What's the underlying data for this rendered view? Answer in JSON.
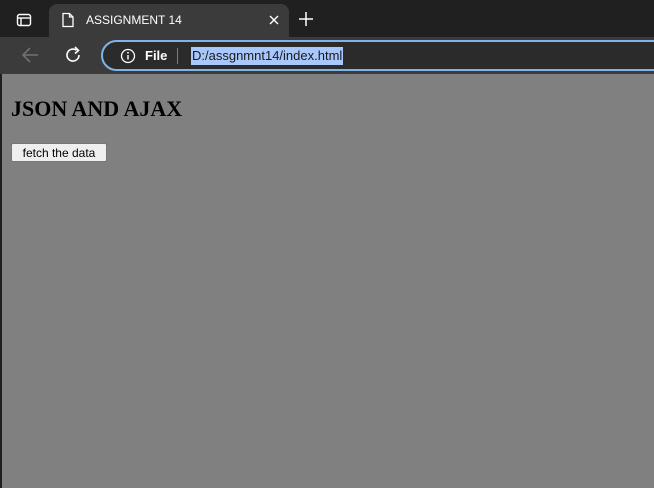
{
  "tab": {
    "title": "ASSIGNMENT 14"
  },
  "omnibox": {
    "scheme_label": "File",
    "url": "D:/assgnmnt14/index.html"
  },
  "page": {
    "heading": "JSON AND AJAX",
    "fetch_button_label": "fetch the data",
    "background_color": "#808080"
  },
  "icons": {
    "tab_actions": "tab-actions-icon",
    "page": "page-icon",
    "close": "close-icon",
    "new_tab": "plus-icon",
    "back": "back-arrow-icon",
    "reload": "reload-icon",
    "info": "info-icon"
  }
}
